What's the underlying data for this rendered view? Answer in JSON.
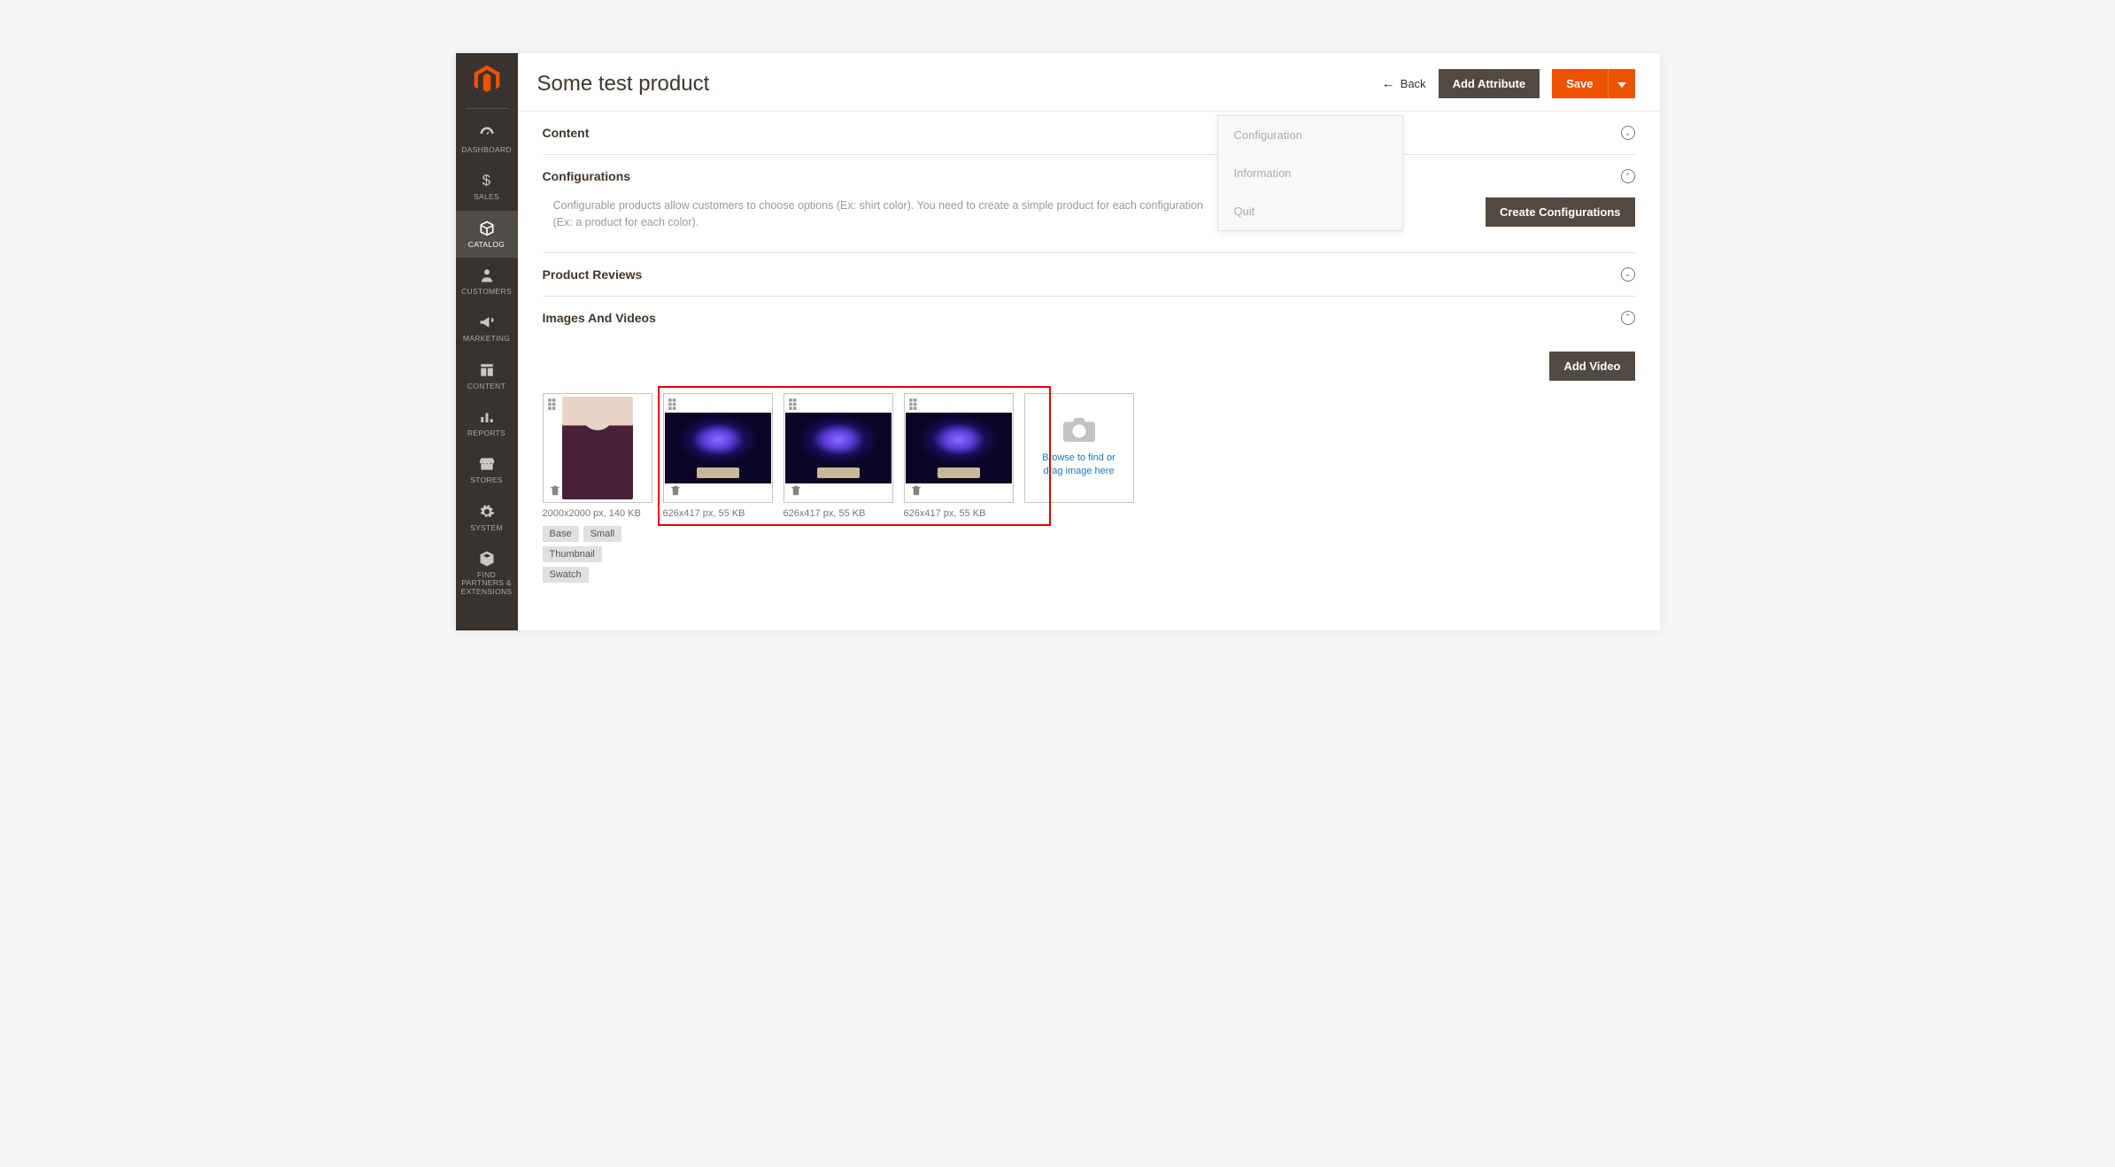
{
  "header": {
    "title": "Some test product",
    "back": "Back",
    "add_attribute": "Add Attribute",
    "save": "Save"
  },
  "context_menu": {
    "items": [
      "Configuration",
      "Information",
      "Quit"
    ]
  },
  "sidebar": {
    "items": [
      {
        "label": "DASHBOARD",
        "icon": "dashboard"
      },
      {
        "label": "SALES",
        "icon": "dollar"
      },
      {
        "label": "CATALOG",
        "icon": "box",
        "active": true
      },
      {
        "label": "CUSTOMERS",
        "icon": "person"
      },
      {
        "label": "MARKETING",
        "icon": "megaphone"
      },
      {
        "label": "CONTENT",
        "icon": "layout"
      },
      {
        "label": "REPORTS",
        "icon": "bars"
      },
      {
        "label": "STORES",
        "icon": "storefront"
      },
      {
        "label": "SYSTEM",
        "icon": "gear"
      },
      {
        "label": "FIND PARTNERS & EXTENSIONS",
        "icon": "package"
      }
    ]
  },
  "sections": {
    "content": {
      "title": "Content"
    },
    "configurations": {
      "title": "Configurations",
      "desc": "Configurable products allow customers to choose options (Ex: shirt color). You need to create a simple product for each configuration (Ex: a product for each color).",
      "button": "Create Configurations"
    },
    "reviews": {
      "title": "Product Reviews"
    },
    "images": {
      "title": "Images And Videos",
      "add_video": "Add Video",
      "upload_text": "Browse to find or drag image here",
      "cards": [
        {
          "meta": "2000x2000 px, 140 KB",
          "kind": "person",
          "tags": [
            "Base",
            "Small",
            "Thumbnail",
            "Swatch"
          ]
        },
        {
          "meta": "626x417 px, 55 KB",
          "kind": "brain"
        },
        {
          "meta": "626x417 px, 55 KB",
          "kind": "brain"
        },
        {
          "meta": "626x417 px, 55 KB",
          "kind": "brain"
        }
      ]
    }
  }
}
